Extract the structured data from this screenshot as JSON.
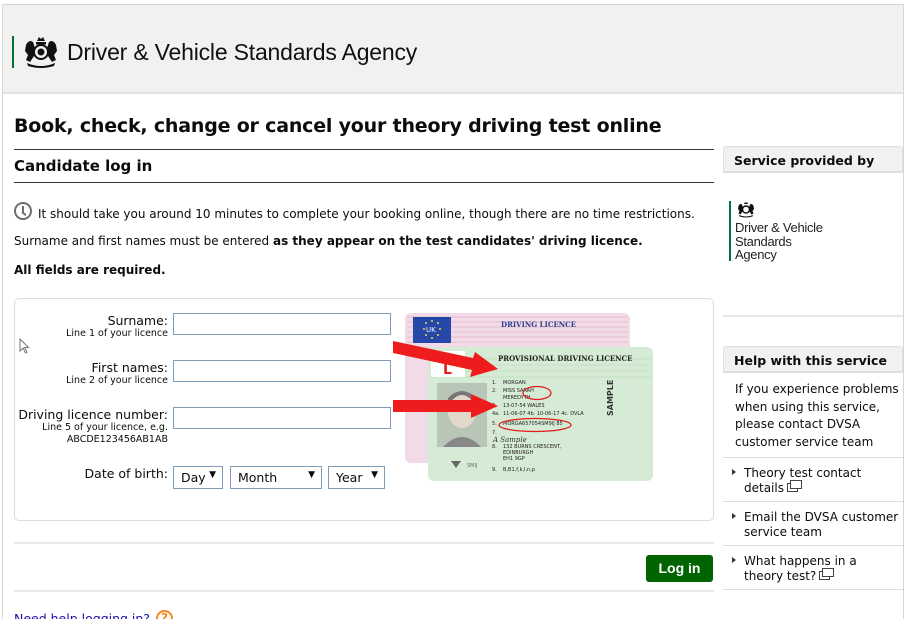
{
  "header": {
    "agency_name": "Driver & Vehicle Standards Agency",
    "logo_icon": "royal-crest-icon"
  },
  "main": {
    "page_title": "Book, check, change or cancel your theory driving test online",
    "section_title": "Candidate log in",
    "time_note": "It should take you around 10 minutes to complete your booking online, though there are no time restrictions.",
    "names_note_prefix": "Surname and first names must be entered ",
    "names_note_bold": "as they appear on the test candidates' driving licence.",
    "required_note": "All fields are required."
  },
  "form": {
    "surname": {
      "label": "Surname:",
      "hint": "Line 1 of your licence",
      "value": ""
    },
    "first_names": {
      "label": "First names:",
      "hint": "Line 2 of your licence",
      "value": ""
    },
    "licence_number": {
      "label": "Driving licence number:",
      "hint_line1": "Line 5 of your licence, e.g.",
      "hint_line2": "ABCDE123456AB1AB",
      "value": ""
    },
    "dob": {
      "label": "Date of birth:",
      "day": "Day",
      "month": "Month",
      "year": "Year"
    },
    "login_button": "Log in",
    "help_link": "Need help logging in?",
    "help_icon": "?"
  },
  "licence_image": {
    "back_card_title": "DRIVING LICENCE",
    "back_card_flag": "UK",
    "front_card_title": "PROVISIONAL DRIVING LICENCE",
    "provisional_tag": "PROVISIONAL",
    "l_plate": "L",
    "lines": [
      {
        "num": "1.",
        "text": "MORGAN"
      },
      {
        "num": "2.",
        "text": "MISS SARAH"
      },
      {
        "num": "",
        "text": "MEREDYTH"
      },
      {
        "num": "3.",
        "text": "13-07-54  WALES"
      },
      {
        "num": "4a.",
        "text": "11-06-07  4b. 10-06-17  4c. DVLA"
      },
      {
        "num": "5.",
        "text": "MORGA657054SM9IJ  85"
      },
      {
        "num": "7.",
        "text": ""
      },
      {
        "num": "8.",
        "text": "132 BURNS CRESCENT,"
      },
      {
        "num": "",
        "text": "EDINBURGH"
      },
      {
        "num": "",
        "text": "EH1 9GP"
      },
      {
        "num": "9.",
        "text": "B,B1,f,k,l,n,p"
      }
    ],
    "sample_watermark": "SAMPLE",
    "signature": "A Sample",
    "accent_red": "#ee1c1c"
  },
  "sidebar": {
    "provided_by_title": "Service provided by",
    "provider_name_lines": [
      "Driver & Vehicle",
      "Standards",
      "Agency"
    ],
    "help_title": "Help with this service",
    "help_text": "If you experience problems when using this service, please contact DVSA customer service team",
    "links": [
      {
        "label": "Theory test contact details",
        "external": true
      },
      {
        "label": "Email the DVSA customer service team",
        "external": false
      },
      {
        "label": "What happens in a theory test?",
        "external": true
      }
    ]
  },
  "colors": {
    "brand_green": "#00703c",
    "button_green": "#006400",
    "header_bg": "#f2f1ef",
    "link_blue": "#1a0dab",
    "help_orange": "#f18a22",
    "input_border": "#7f9db9"
  }
}
